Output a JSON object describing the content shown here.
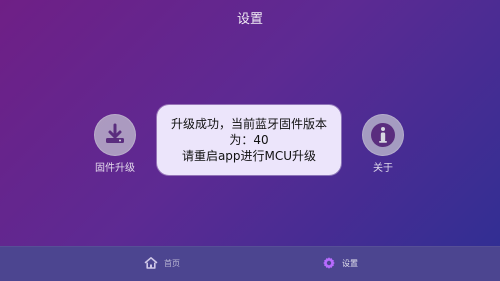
{
  "header": {
    "title": "设置"
  },
  "features": [
    {
      "label": "固件升级",
      "icon": "download-icon"
    },
    {
      "label": "关于",
      "icon": "info-icon"
    }
  ],
  "dialog": {
    "line1": "升级成功，当前蓝牙固件版本",
    "line2": "为：40",
    "line3": "请重启app进行MCU升级"
  },
  "nav": {
    "items": [
      {
        "label": "首页",
        "icon": "home-icon",
        "active": false
      },
      {
        "label": "设置",
        "icon": "gear-icon",
        "active": true
      }
    ]
  },
  "colors": {
    "background_start": "#6f1f86",
    "background_end": "#2e2f93",
    "dialog_bg": "#ece5fb",
    "bottom_nav_bg": "#4c4590",
    "icon_bg": "#c8c8d2",
    "icon_fg": "#5a2d7e"
  }
}
